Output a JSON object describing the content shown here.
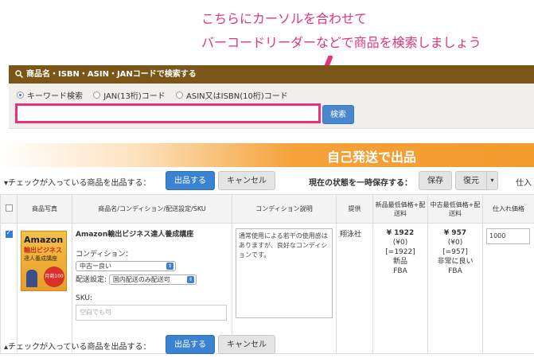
{
  "annotation": {
    "line1": "こちらにカーソルを合わせて",
    "line2": "バーコードリーダーなどで商品を検索しましょう",
    "color": "#e5327a"
  },
  "search": {
    "header": "商品名・ISBN・ASIN・JANコードで検索する",
    "radios": [
      {
        "label": "キーワード検索",
        "selected": true
      },
      {
        "label": "JAN(13桁)コード",
        "selected": false
      },
      {
        "label": "ASIN又はISBN(10桁)コード",
        "selected": false
      }
    ],
    "input_value": "",
    "button": "検索"
  },
  "banner": {
    "title": "自己発送で出品"
  },
  "toolbar": {
    "checked_text": "チェックが入っている商品を出品する：",
    "list_button": "出品する",
    "cancel_button": "キャンセル",
    "save_state_label": "現在の状態を一時保存する：",
    "save_button": "保存",
    "restore_button": "復元",
    "purchase_label": "仕入"
  },
  "table": {
    "headers": [
      "商品写真",
      "商品名/コンディション/配送設定/SKU",
      "コンディション説明",
      "提供",
      "新品最低価格+配送料",
      "中古最低価格+配送料",
      "仕入れ価格"
    ],
    "row": {
      "checked": true,
      "book_cover": {
        "title": "Amazon",
        "subtitle": "輸出ビジネス",
        "tagline": "達人養成講座",
        "seal": "月商100万円"
      },
      "product_name": "Amazon輸出ビジネス達人養成講座",
      "condition_label": "コンディション：",
      "condition_value": "中古ー良い",
      "shipping_label": "配送設定:",
      "shipping_value": "国内配送のみ配送可",
      "sku_label": "SKU:",
      "sku_placeholder": "空白でも可",
      "condition_note": "通常使用による若干の使用感はありますが、良好なコンディションです。",
      "provider": "翔泳社",
      "new_price": [
        "¥ 1922",
        "(¥0)",
        "[=1922]",
        "新品",
        "FBA"
      ],
      "used_price": [
        "¥ 957",
        "(¥0)",
        "[=957]",
        "非常に良い",
        "FBA"
      ],
      "purchase_price": "1000"
    }
  }
}
